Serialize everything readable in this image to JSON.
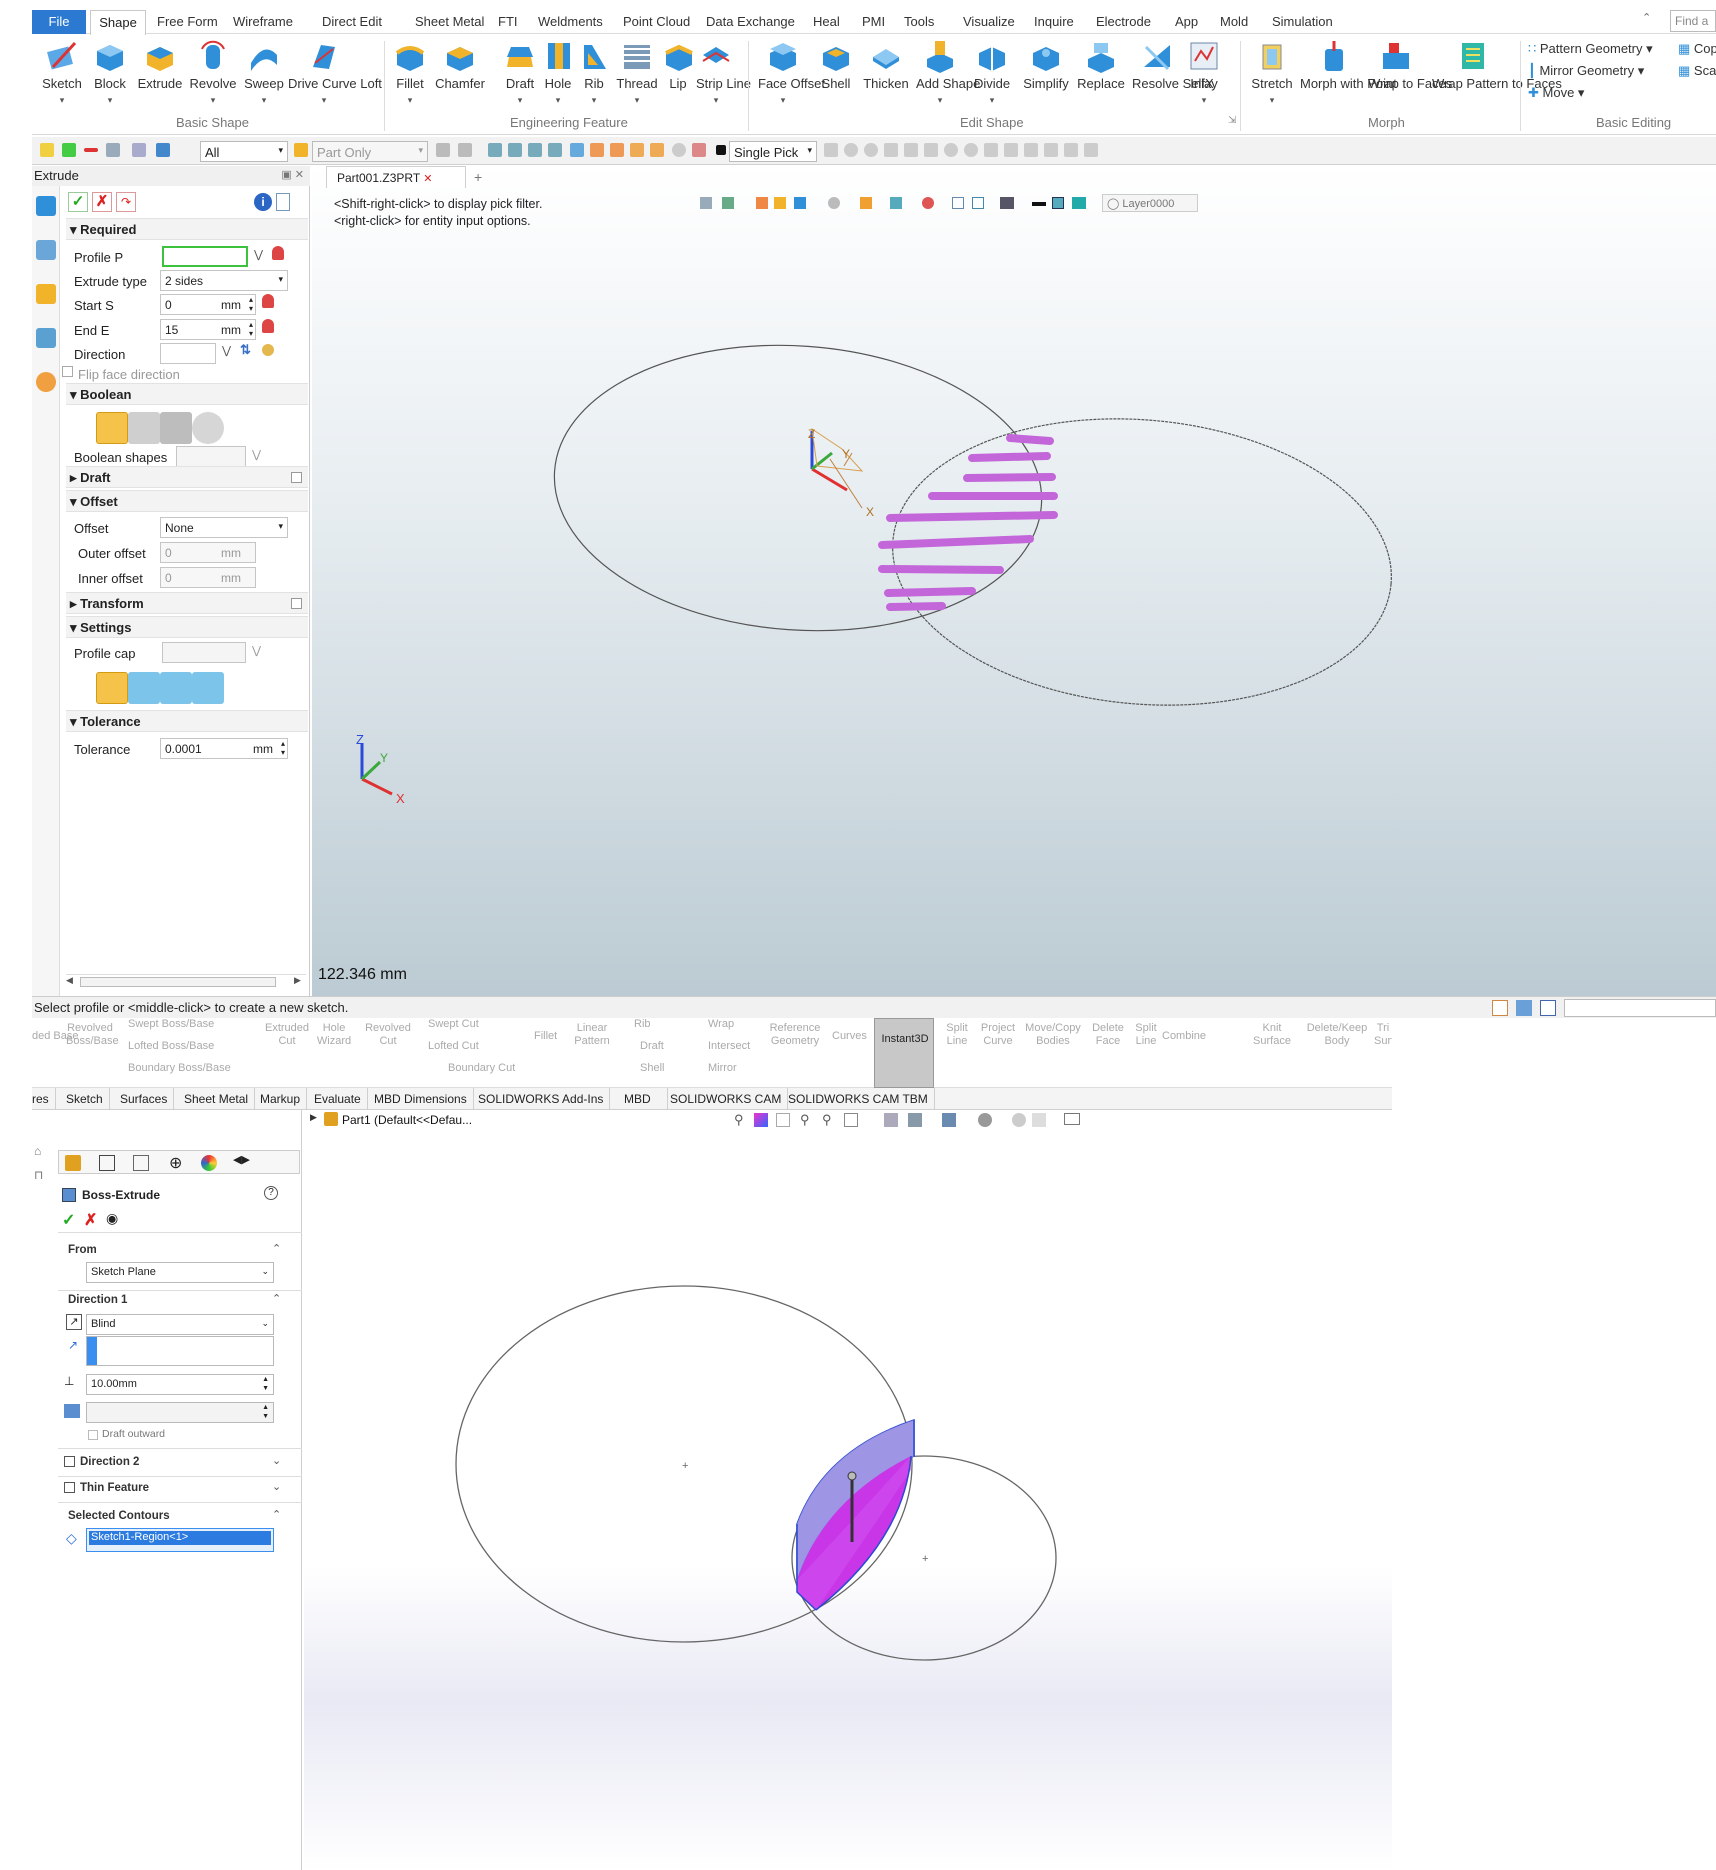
{
  "zw3d": {
    "menu": {
      "file": "File",
      "tabs": [
        "Shape",
        "Free Form",
        "Wireframe",
        "Direct Edit",
        "Sheet Metal",
        "FTI",
        "Weldments",
        "Point Cloud",
        "Data Exchange",
        "Heal",
        "PMI",
        "Tools",
        "Visualize",
        "Inquire",
        "Electrode",
        "App",
        "Mold",
        "Simulation"
      ],
      "find_placeholder": "Find a"
    },
    "ribbon": {
      "basic_shape": {
        "label": "Basic Shape",
        "buttons": [
          "Sketch",
          "Block",
          "Extrude",
          "Revolve",
          "Sweep",
          "Drive Curve Loft"
        ]
      },
      "engineering_feature": {
        "label": "Engineering Feature",
        "buttons": [
          "Fillet",
          "Chamfer",
          "Draft",
          "Hole",
          "Rib",
          "Thread",
          "Lip",
          "Strip Line"
        ]
      },
      "edit_shape": {
        "label": "Edit Shape",
        "buttons": [
          "Face Offset",
          "Shell",
          "Thicken",
          "Add Shape",
          "Divide",
          "Simplify",
          "Replace",
          "Resolve SelfX",
          "Inlay"
        ]
      },
      "morph": {
        "label": "Morph",
        "buttons": [
          "Stretch",
          "Morph with Point",
          "Wrap to Faces",
          "Wrap Pattern to Faces"
        ]
      },
      "basic_editing": {
        "label": "Basic Editing",
        "items": [
          "Pattern Geometry",
          "Mirror Geometry",
          "Move",
          "Cop",
          "Sca"
        ]
      }
    },
    "toolbar": {
      "filter": "All",
      "scope": "Part Only",
      "pick": "Single Pick",
      "layer": "Layer0000"
    },
    "panel": {
      "title": "Extrude",
      "required": "Required",
      "profile_label": "Profile P",
      "extrude_type_label": "Extrude type",
      "extrude_type_value": "2 sides",
      "start_label": "Start S",
      "start_value": "0",
      "end_label": "End E",
      "end_value": "15",
      "unit": "mm",
      "direction_label": "Direction",
      "flip_label": "Flip face direction",
      "boolean": "Boolean",
      "boolean_shapes_label": "Boolean shapes",
      "draft": "Draft",
      "offset": "Offset",
      "offset_label": "Offset",
      "offset_value": "None",
      "outer_offset_label": "Outer offset",
      "outer_offset_value": "0",
      "inner_offset_label": "Inner offset",
      "inner_offset_value": "0",
      "transform": "Transform",
      "settings": "Settings",
      "profile_cap_label": "Profile cap",
      "tolerance": "Tolerance",
      "tolerance_label": "Tolerance",
      "tolerance_value": "0.0001"
    },
    "viewport": {
      "tab": "Part001.Z3PRT",
      "hint_1": "<Shift-right-click> to display pick filter.",
      "hint_2": "<right-click> for entity input options.",
      "scale": "122.346 mm",
      "axis_labels": [
        "X",
        "Y",
        "Z"
      ],
      "highlight_color": "#c266d9"
    },
    "status": "Select profile or <middle-click> to create a new sketch."
  },
  "solidworks": {
    "ribbon": {
      "items": [
        "ded Base",
        "Revolved Boss/Base",
        "Swept Boss/Base",
        "Lofted Boss/Base",
        "Boundary Boss/Base",
        "Extruded Cut",
        "Hole Wizard",
        "Revolved Cut",
        "Swept Cut",
        "Lofted Cut",
        "Boundary Cut",
        "Fillet",
        "Linear Pattern",
        "Rib",
        "Draft",
        "Shell",
        "Wrap",
        "Intersect",
        "Mirror",
        "Reference Geometry",
        "Curves",
        "Instant3D",
        "Split Line",
        "Project Curve",
        "Move/Copy Bodies",
        "Delete Face",
        "Split Line",
        "Combine",
        "Knit Surface",
        "Delete/Keep Body",
        "Tri Surf"
      ]
    },
    "tabs": [
      "res",
      "Sketch",
      "Surfaces",
      "Sheet Metal",
      "Markup",
      "Evaluate",
      "MBD Dimensions",
      "SOLIDWORKS Add-Ins",
      "MBD",
      "SOLIDWORKS CAM",
      "SOLIDWORKS CAM TBM"
    ],
    "tree_root": "Part1  (Default<<Defau...",
    "pm": {
      "title": "Boss-Extrude",
      "from": "From",
      "from_value": "Sketch Plane",
      "direction1": "Direction 1",
      "end_condition": "Blind",
      "depth": "10.00mm",
      "draft_outward": "Draft outward",
      "direction2": "Direction 2",
      "thin_feature": "Thin Feature",
      "selected_contours": "Selected Contours",
      "contour_item": "Sketch1-Region<1>"
    },
    "highlight_color": "#cc44ee",
    "accent": "#2b6ed9"
  }
}
